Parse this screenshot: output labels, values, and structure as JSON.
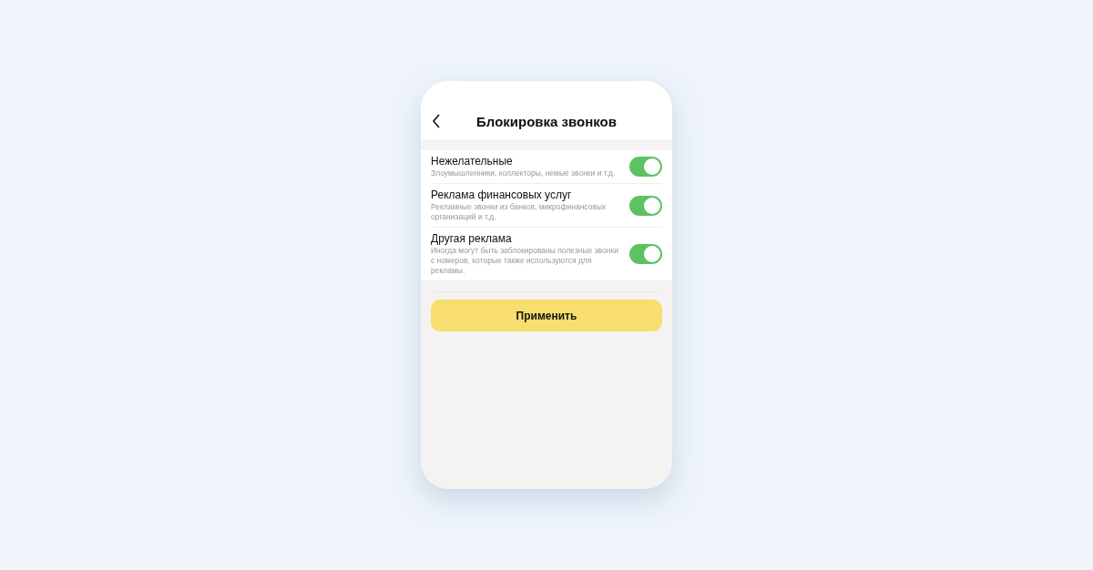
{
  "header": {
    "title": "Блокировка звонков"
  },
  "settings": [
    {
      "title": "Нежелательные",
      "description": "Злоумышленники, коллекторы, немые звонки и т.д.",
      "on": true
    },
    {
      "title": "Реклама финансовых услуг",
      "description": "Рекламные звонки из банков, микрофинансовых организаций и т.д.",
      "on": true
    },
    {
      "title": "Другая реклама",
      "description": "Иногда могут быть заблокированы полезные звонки с номеров, которые также используются для рекламы.",
      "on": true
    }
  ],
  "apply_button": "Применить"
}
